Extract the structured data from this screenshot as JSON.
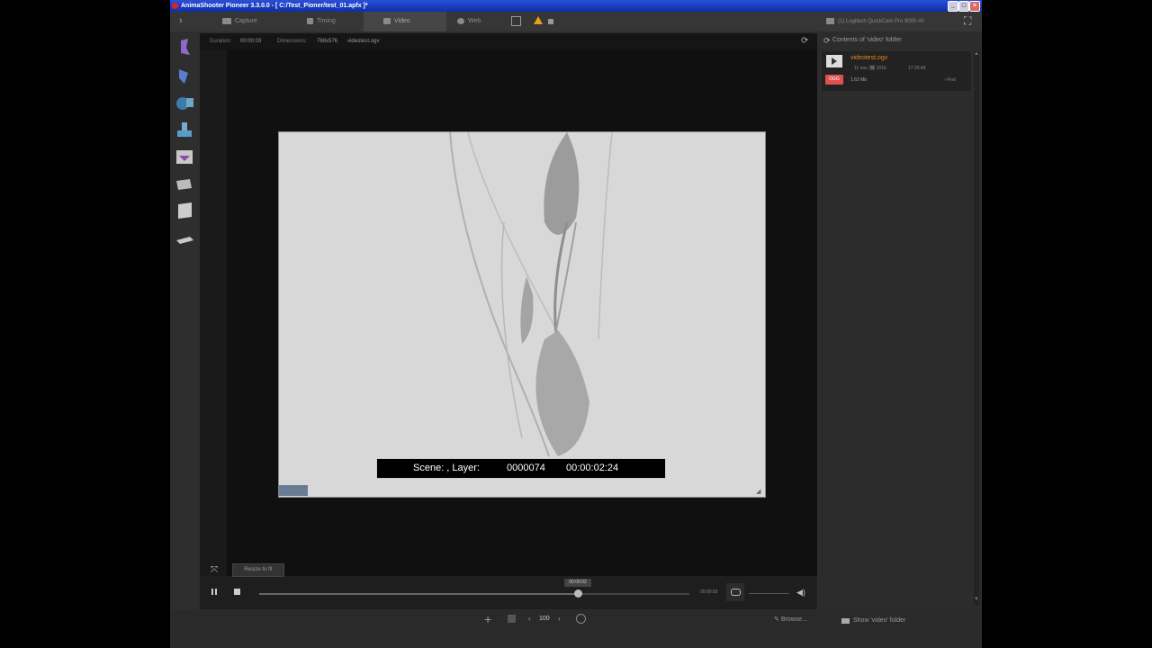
{
  "window": {
    "title": "AnimaShooter Pioneer 3.3.0.0 - [ C:/Test_Pioner/test_01.apfx ]*",
    "controls": [
      "minimize",
      "maximize",
      "close"
    ]
  },
  "tabs": [
    {
      "label": "Capture",
      "icon": "camera-icon",
      "active": false
    },
    {
      "label": "Timing",
      "icon": "runner-icon",
      "active": false
    },
    {
      "label": "Video",
      "icon": "film-icon",
      "active": true
    },
    {
      "label": "Web",
      "icon": "globe-icon",
      "active": false
    }
  ],
  "tab_extras": {
    "grid_icon": "grid-icon",
    "warning_icon": "warning-icon",
    "lock_icon": "lock-icon"
  },
  "camera": {
    "label": "(1) Logitech QuickCam Pro 9000 #0",
    "fullscreen_icon": "fullscreen-icon"
  },
  "info": {
    "duration_label": "Duration:",
    "duration_value": "00:00:03",
    "dimensions_label": "Dimensions:",
    "dimensions_value": "768x576",
    "filename": "videotest.ogv"
  },
  "overlay": {
    "scene_layer": "Scene: , Layer:",
    "frame": "0000074",
    "timecode": "00:00:02:24"
  },
  "controls": {
    "resize_tooltip": "Resize to fit",
    "playhead_label": "00:00:02",
    "end_time": "00:00:03",
    "progress": 0.74
  },
  "right_panel": {
    "header": "Contents of 'video' folder",
    "file": {
      "name": "videotest.ogv",
      "date": "11 nov. 🗓 2016",
      "time": "17:20:49",
      "badge": "OGG",
      "size": "1.62 Mb",
      "find": "Find"
    }
  },
  "bottom": {
    "zoom": "100",
    "browse": "Browse...",
    "show_folder": "Show 'video' folder"
  },
  "colors": {
    "accent_orange": "#e08a1e",
    "badge_red": "#e05050",
    "title_blue": "#1a3fcf"
  }
}
